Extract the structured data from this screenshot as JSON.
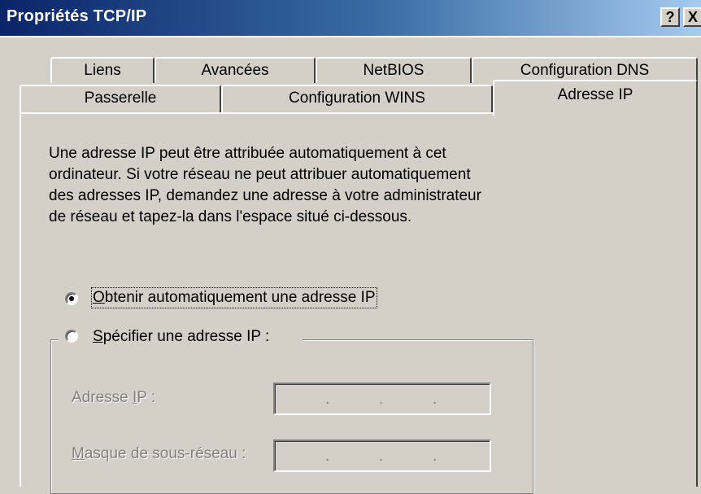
{
  "window": {
    "title": "Propriétés TCP/IP",
    "help_button": "?",
    "close_button": "X"
  },
  "tabs": {
    "row1": [
      "Liens",
      "Avancées",
      "NetBIOS",
      "Configuration DNS"
    ],
    "row2": [
      "Passerelle",
      "Configuration WINS"
    ],
    "active": "Adresse IP"
  },
  "panel": {
    "description_lines": [
      "Une adresse IP peut être attribuée automatiquement à cet",
      "ordinateur. Si votre réseau ne peut attribuer automatiquement",
      "des adresses IP, demandez une adresse à votre administrateur",
      "de réseau et tapez-la dans l'espace situé ci-dessous."
    ],
    "radio_auto": {
      "mnemonic": "O",
      "label_rest": "btenir automatiquement une adresse IP",
      "selected": true
    },
    "radio_manual": {
      "mnemonic": "S",
      "label_rest": "pécifier une adresse IP :",
      "selected": false
    },
    "fields": {
      "ip_label_pre": "Adresse ",
      "ip_label_mnemonic": "I",
      "ip_label_post": "P :",
      "ip_value": "",
      "mask_label_mnemonic": "M",
      "mask_label_rest": "asque de sous-réseau :",
      "mask_value": ""
    }
  },
  "colors": {
    "face": "#d4d0c8",
    "title_start": "#0a246a",
    "title_end": "#a6caf0",
    "disabled_text": "#808080"
  }
}
